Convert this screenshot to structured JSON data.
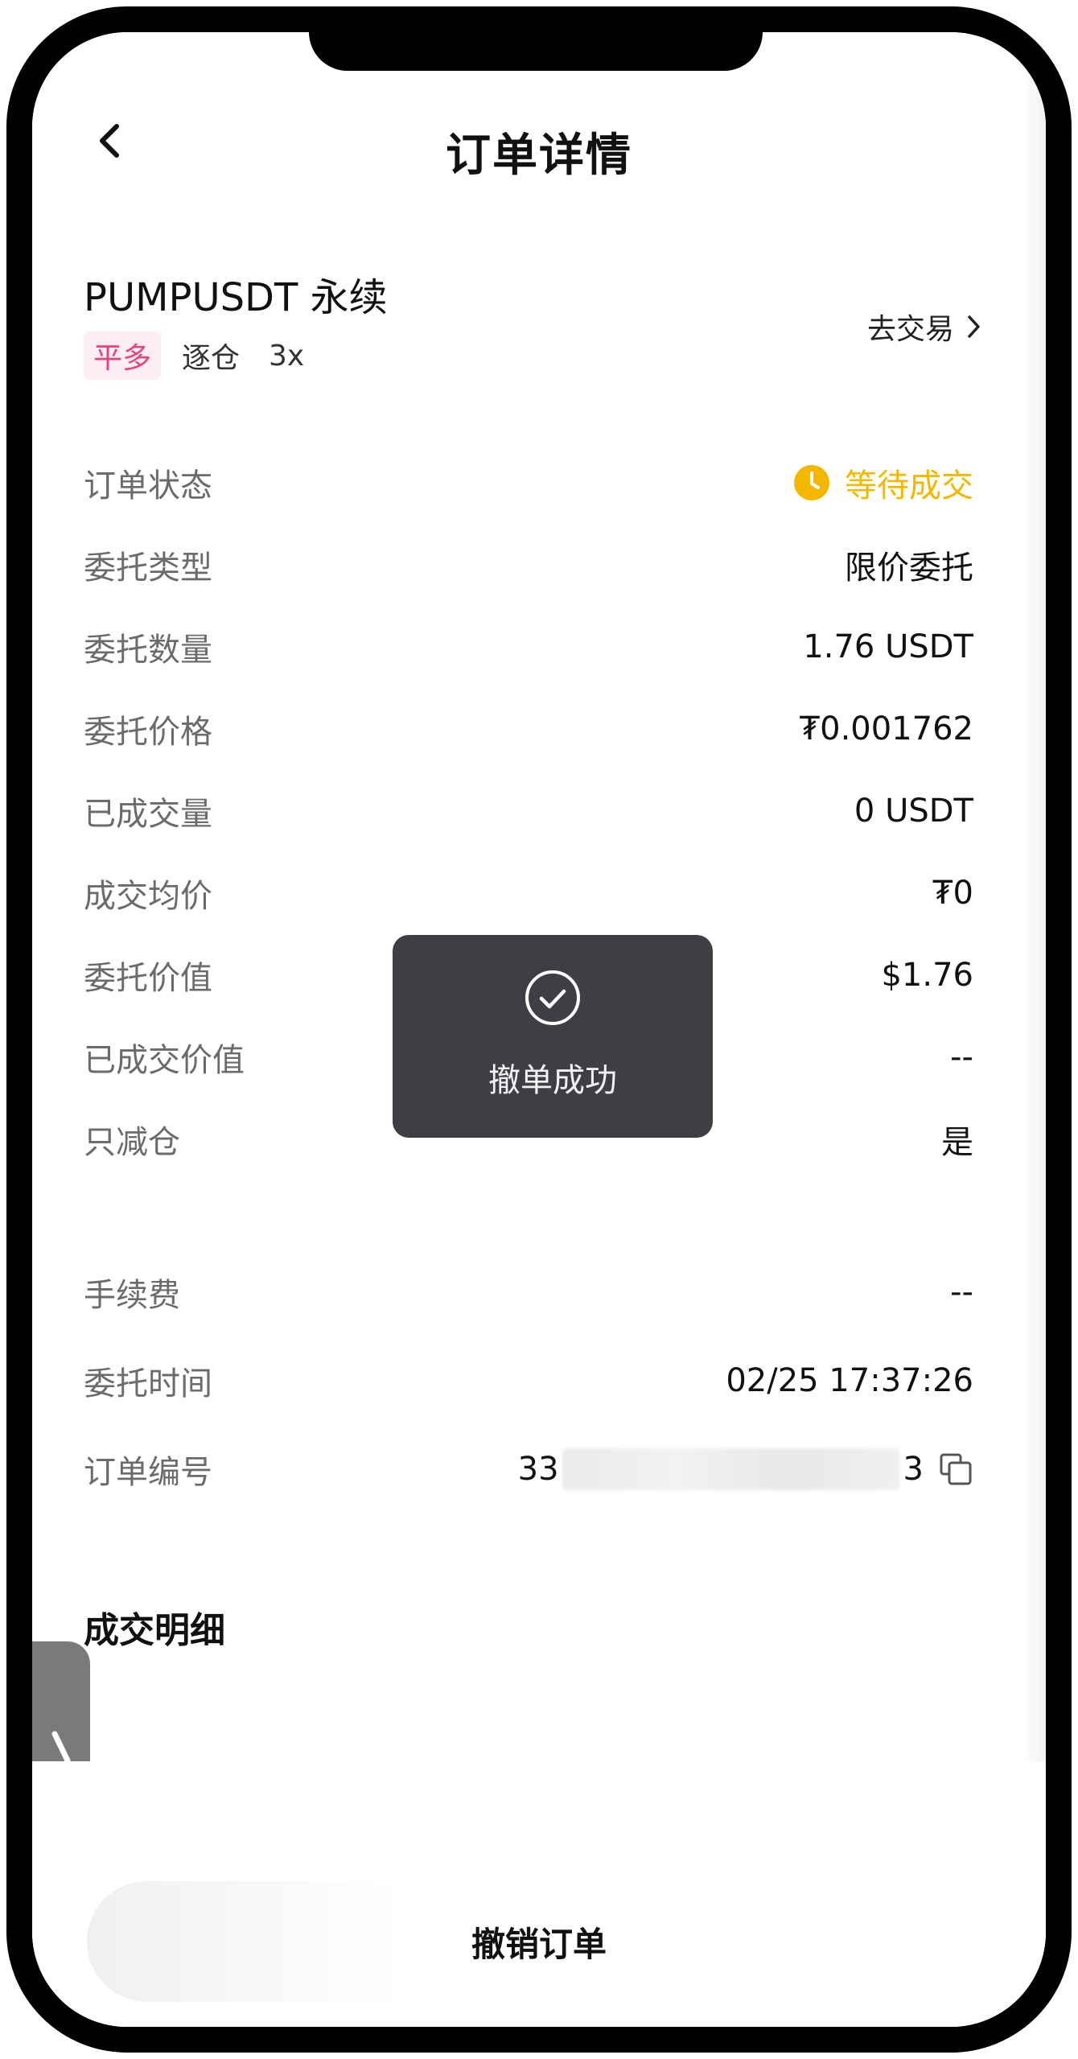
{
  "header": {
    "title": "订单详情"
  },
  "pair": {
    "name": "PUMPUSDT 永续",
    "side": "平多",
    "margin_mode": "逐仓",
    "leverage": "3x",
    "go_trade_label": "去交易"
  },
  "details": [
    {
      "label": "订单状态",
      "value": "等待成交"
    },
    {
      "label": "委托类型",
      "value": "限价委托"
    },
    {
      "label": "委托数量",
      "value": "1.76 USDT"
    },
    {
      "label": "委托价格",
      "value": "₮0.001762"
    },
    {
      "label": "已成交量",
      "value": "0 USDT"
    },
    {
      "label": "成交均价",
      "value": "₮0"
    },
    {
      "label": "委托价值",
      "value": "$1.76"
    },
    {
      "label": "已成交价值",
      "value": "--"
    },
    {
      "label": "只减仓",
      "value": "是"
    }
  ],
  "extra": [
    {
      "label": "手续费",
      "value": "--"
    },
    {
      "label": "委托时间",
      "value": "02/25 17:37:26"
    },
    {
      "label": "订单编号",
      "value_prefix": "33",
      "value_suffix": "3"
    }
  ],
  "section": {
    "fills_title": "成交明细"
  },
  "toast": {
    "message": "撤单成功"
  },
  "footer": {
    "cancel_label": "撤销订单"
  },
  "colors": {
    "status_pending": "#f5b800",
    "side_tag_text": "#e8447a",
    "side_tag_bg": "#fdeef3",
    "toast_bg": "#3e3e44"
  }
}
